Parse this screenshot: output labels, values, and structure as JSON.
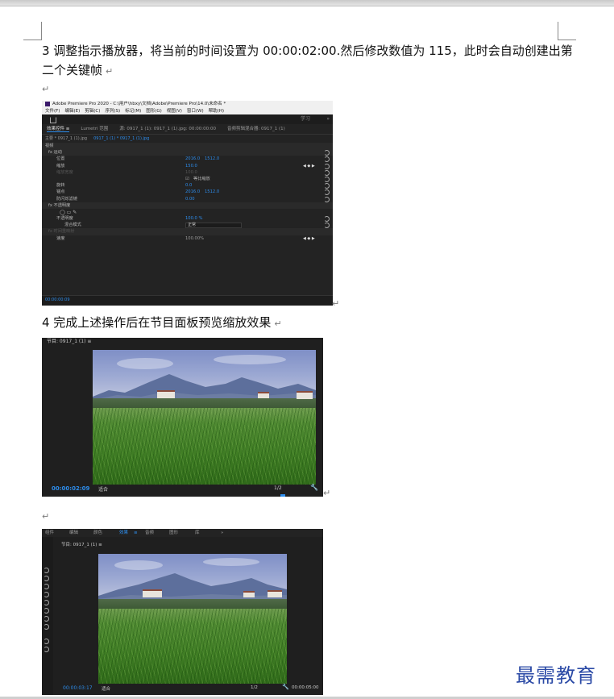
{
  "document": {
    "step3_text": "3 调整指示播放器，将当前的时间设置为 00:00:02:00.然后修改数值为 115，此时会自动创建出第二个关键帧",
    "step4_text": "4 完成上述操作后在节目面板预览缩放效果",
    "paragraph_mark": "↵",
    "brand": "最需教育"
  },
  "premiere": {
    "window_title": "Adobe Premiere Pro 2020 - C:\\用户\\hbxy\\文档\\Adobe\\Premiere Pro\\14.0\\未命名 *",
    "menu": [
      "文件(F)",
      "编辑(E)",
      "剪辑(C)",
      "序列(S)",
      "标记(M)",
      "图形(G)",
      "视图(V)",
      "窗口(W)",
      "帮助(H)"
    ],
    "workspace_learn": "学习",
    "workspace_more": "»",
    "tabs": [
      "效果控件 ≡",
      "Lumetri 范围",
      "源: 0917_1 (1): 0917_1 (1).jpg: 00:00:00:00",
      "音频剪辑混合器: 0917_1 (1)"
    ],
    "clip_master": "主要 * 0917_1 (1).jpg",
    "clip_seq": "0917_1 (1) * 0917_1 (1).jpg",
    "section_video": "视频",
    "rows": [
      {
        "label": "fx  运动",
        "type": "section"
      },
      {
        "label": "位置",
        "v1": "2016.0",
        "v2": "1512.0"
      },
      {
        "label": "缩放",
        "v1": "150.0",
        "kf": "◀ ◆ ▶"
      },
      {
        "label": "缩放宽度",
        "v1": "100.0",
        "dim": true
      },
      {
        "label": "",
        "checkbox": "等比缩放"
      },
      {
        "label": "旋转",
        "v1": "0.0"
      },
      {
        "label": "锚点",
        "v1": "2016.0",
        "v2": "1512.0"
      },
      {
        "label": "防闪烁滤镜",
        "v1": "0.00"
      },
      {
        "label": "fx  不透明度",
        "type": "section"
      },
      {
        "label": "",
        "shapes": "◯ ▭ ✎"
      },
      {
        "label": "不透明度",
        "v1": "100.0 %"
      },
      {
        "label": "混合模式",
        "select": "正常"
      },
      {
        "label": "fx  时间重映射",
        "type": "section",
        "dim": true
      },
      {
        "label": "速度",
        "v1": "100.00%"
      }
    ],
    "bottom_timecode": "00:00:00:09"
  },
  "monitor1": {
    "title": "节目: 0917_1 (1)  ≡",
    "timecode": "00:00:02:09",
    "fit": "适合",
    "resolution": "1/2"
  },
  "monitor2": {
    "tabs": [
      "组件",
      "编辑",
      "颜色",
      "效果",
      "≡",
      "音频",
      "图形",
      "库",
      "»"
    ],
    "title": "节目: 0917_1 (1)  ≡",
    "timecode": "00:00:03:17",
    "fit": "适合",
    "resolution": "1/2",
    "end_timecode": "00:00:05:00"
  },
  "colors": {
    "premiere_blue": "#2d8ceb",
    "panel_bg": "#232323",
    "brand_blue": "#2b4aa6"
  }
}
